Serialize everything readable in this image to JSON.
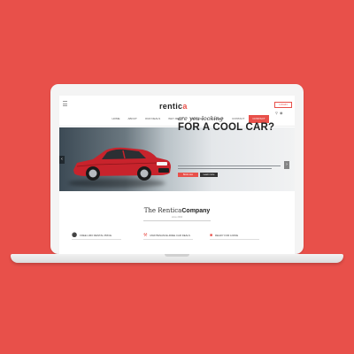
{
  "site": {
    "logo_text": "rentic",
    "logo_dot": "a",
    "login_label": "LOGIN"
  },
  "nav": {
    "items": [
      "Home",
      "About",
      "Our Deals",
      "Why Rent",
      "Services",
      "Gallery",
      "Contact"
    ],
    "cta": "Contact"
  },
  "hero": {
    "subtitle": "are you looking",
    "title": "FOR A COOL CAR?",
    "primary_button": "Book now",
    "secondary_button": "Learn more",
    "prev_arrow": "‹",
    "next_arrow": "›"
  },
  "company": {
    "title_light": "The Rentica",
    "title_bold": "Company",
    "subtitle": "since 2004"
  },
  "features": [
    {
      "icon": "gift-icon",
      "label": "Free limo rental price"
    },
    {
      "icon": "wrench-icon",
      "label": "Maintenance-free car deals"
    },
    {
      "icon": "car-icon",
      "label": "Ready for a ride"
    }
  ],
  "colors": {
    "background": "#E8504A",
    "accent": "#E8504A",
    "car": "#C8232C"
  }
}
